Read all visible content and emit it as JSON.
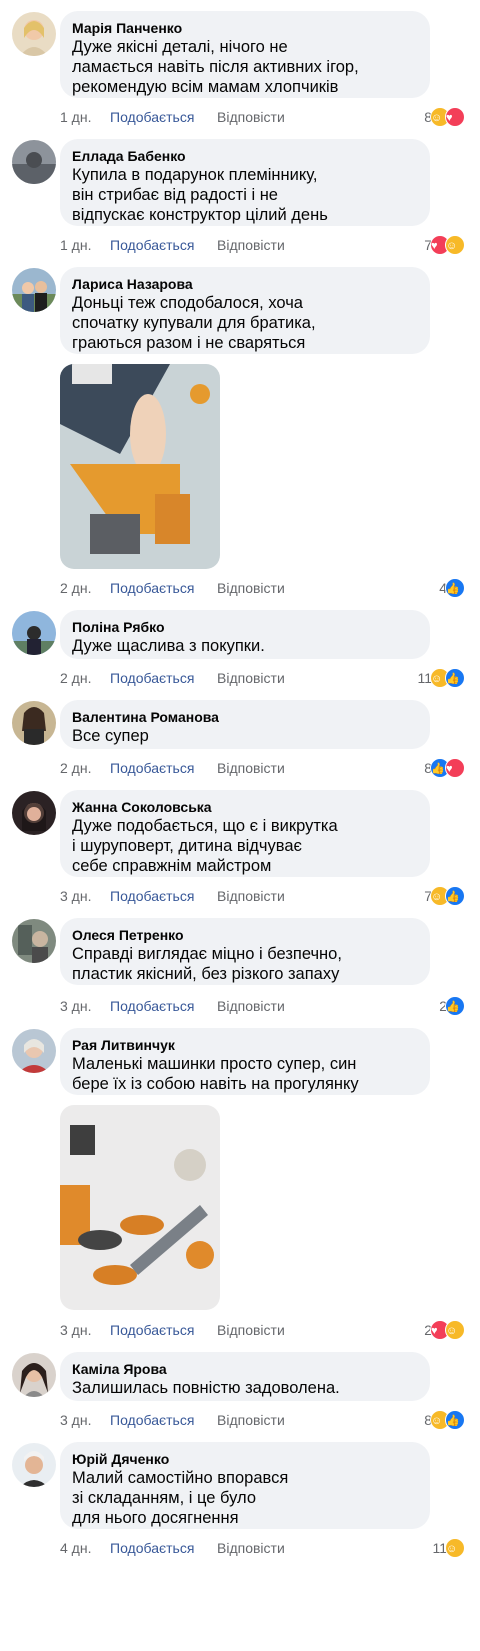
{
  "comments": [
    {
      "author": "Марія Панченко",
      "text": "Дуже якісні деталі, нічого не\nламається навіть після активних ігор,\nрекомендую всім мамам хлопчиків",
      "time": "1 дн.",
      "like": "Подобається",
      "reply": "Відповісти",
      "count": "8",
      "reactions": [
        "care-icon",
        "love-icon"
      ]
    },
    {
      "author": "Еллада Бабенко",
      "text": "Купила в подарунок племіннику,\nвін стрибає від радості і не\nвідпускає конструктор цілий день",
      "time": "1 дн.",
      "like": "Подобається",
      "reply": "Відповісти",
      "count": "7",
      "reactions": [
        "love-icon",
        "care-icon"
      ]
    },
    {
      "author": "Лариса Назарова",
      "text": "Доньці теж сподобалося, хоча\nспочатку купували для братика,\nграються разом і не сваряться",
      "time": "2 дн.",
      "like": "Подобається",
      "reply": "Відповісти",
      "count": "4",
      "reactions": [
        "like-icon"
      ]
    },
    {
      "author": "Поліна Рябко",
      "text": "Дуже щаслива з покупки.",
      "time": "2 дн.",
      "like": "Подобається",
      "reply": "Відповісти",
      "count": "11",
      "reactions": [
        "care-icon",
        "like-icon"
      ]
    },
    {
      "author": "Валентина Романова",
      "text": "Все супер",
      "time": "2 дн.",
      "like": "Подобається",
      "reply": "Відповісти",
      "count": "8",
      "reactions": [
        "like-icon",
        "love-icon"
      ]
    },
    {
      "author": "Жанна Соколовська",
      "text": "Дуже подобається, що є і викрутка\nі шуруповерт, дитина відчуває\nсебе справжнім майстром",
      "time": "3 дн.",
      "like": "Подобається",
      "reply": "Відповісти",
      "count": "7",
      "reactions": [
        "care-icon",
        "like-icon"
      ]
    },
    {
      "author": "Олеся Петренко",
      "text": "Справді виглядає міцно і безпечно,\nпластик якісний, без різкого запаху",
      "time": "3 дн.",
      "like": "Подобається",
      "reply": "Відповісти",
      "count": "2",
      "reactions": [
        "like-icon"
      ]
    },
    {
      "author": "Рая Литвинчук",
      "text": "Маленькі машинки просто супер, син\nбере їх із собою навіть на прогулянку",
      "time": "3 дн.",
      "like": "Подобається",
      "reply": "Відповісти",
      "count": "2",
      "reactions": [
        "love-icon",
        "care-icon"
      ]
    },
    {
      "author": "Каміла Ярова",
      "text": "Залишилась повністю задоволена.",
      "time": "3 дн.",
      "like": "Подобається",
      "reply": "Відповісти",
      "count": "8",
      "reactions": [
        "care-icon",
        "like-icon"
      ]
    },
    {
      "author": "Юрій Дяченко",
      "text": "Малий самостійно впорався\nзі складанням, і це було\nдля нього досягнення",
      "time": "4 дн.",
      "like": "Подобається",
      "reply": "Відповісти",
      "count": "11",
      "reactions": [
        "care-icon"
      ]
    }
  ],
  "colors": {
    "bubble": "#f0f2f5",
    "link": "#385898",
    "meta": "#65676b",
    "like": "#1877f2",
    "love": "#f33e58",
    "care": "#f7b928"
  }
}
